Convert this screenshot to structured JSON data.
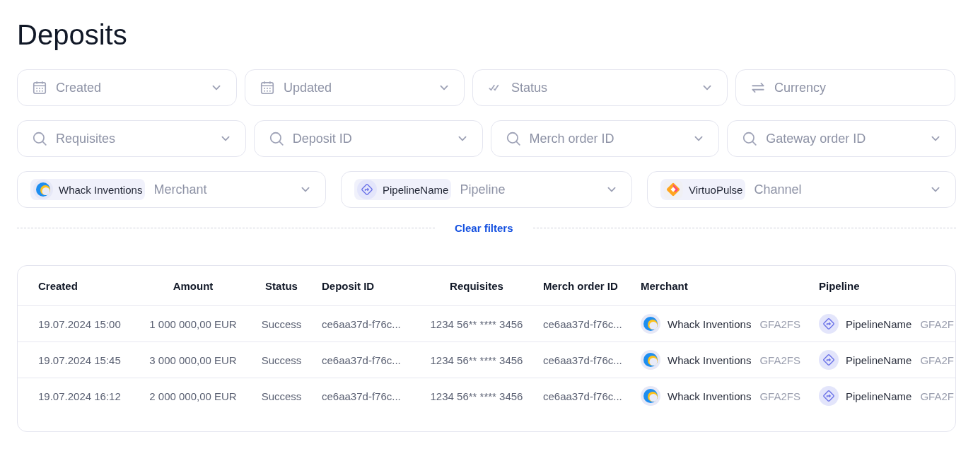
{
  "page": {
    "title": "Deposits"
  },
  "filter_rows": [
    [
      {
        "kind": "date",
        "placeholder": "Created",
        "dropdown": true
      },
      {
        "kind": "date",
        "placeholder": "Updated",
        "dropdown": true
      },
      {
        "kind": "status",
        "placeholder": "Status",
        "dropdown": true
      },
      {
        "kind": "currency",
        "placeholder": "Currency",
        "dropdown": false
      }
    ],
    [
      {
        "kind": "search",
        "placeholder": "Requisites",
        "dropdown": true
      },
      {
        "kind": "search",
        "placeholder": "Deposit ID",
        "dropdown": true
      },
      {
        "kind": "search",
        "placeholder": "Merch order ID",
        "dropdown": true
      },
      {
        "kind": "search",
        "placeholder": "Gateway order ID",
        "dropdown": true
      }
    ],
    [
      {
        "kind": "merchant",
        "chip": "Whack Inventions",
        "placeholder": "Merchant",
        "dropdown": true
      },
      {
        "kind": "pipeline",
        "chip": "PipelineName",
        "placeholder": "Pipeline",
        "dropdown": true
      },
      {
        "kind": "channel",
        "chip": "VirtuoPulse",
        "placeholder": "Channel",
        "dropdown": true
      }
    ]
  ],
  "clear_filters": "Clear filters",
  "table": {
    "columns": [
      "Created",
      "Amount",
      "Status",
      "Deposit ID",
      "Requisites",
      "Merch order ID",
      "Merchant",
      "Pipeline"
    ],
    "rows": [
      {
        "created": "19.07.2024 15:00",
        "amount": "1 000 000,00 EUR",
        "status": "Success",
        "deposit_id": "ce6aa37d-f76c...",
        "requisites": "1234 56** **** 3456",
        "merch_order_id": "ce6aa37d-f76c...",
        "merchant": {
          "name": "Whack Inventions",
          "code": "GFA2FS"
        },
        "pipeline": {
          "name": "PipelineName",
          "code": "GFA2F"
        }
      },
      {
        "created": "19.07.2024 15:45",
        "amount": "3 000 000,00 EUR",
        "status": "Success",
        "deposit_id": "ce6aa37d-f76c...",
        "requisites": "1234 56** **** 3456",
        "merch_order_id": "ce6aa37d-f76c...",
        "merchant": {
          "name": "Whack Inventions",
          "code": "GFA2FS"
        },
        "pipeline": {
          "name": "PipelineName",
          "code": "GFA2F"
        }
      },
      {
        "created": "19.07.2024 16:12",
        "amount": "2 000 000,00 EUR",
        "status": "Success",
        "deposit_id": "ce6aa37d-f76c...",
        "requisites": "1234 56** **** 3456",
        "merch_order_id": "ce6aa37d-f76c...",
        "merchant": {
          "name": "Whack Inventions",
          "code": "GFA2FS"
        },
        "pipeline": {
          "name": "PipelineName",
          "code": "GFA2F"
        }
      }
    ]
  }
}
